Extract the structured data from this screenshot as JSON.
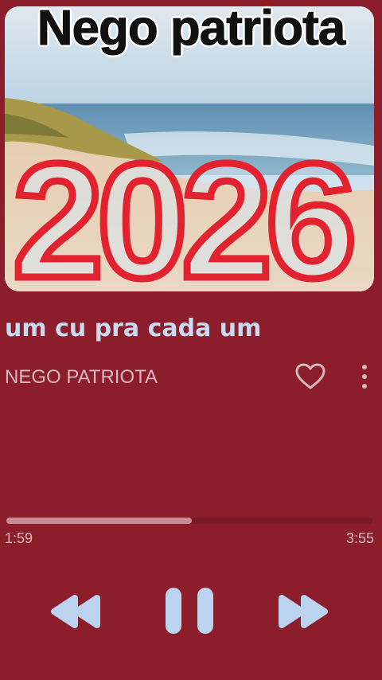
{
  "overlay": {
    "title": "Nego patriota"
  },
  "artwork": {
    "year_text": "2026",
    "icon": "album-artwork"
  },
  "track": {
    "title": "um cu pra cada um",
    "artist": "NEGO PATRIOTA",
    "elapsed": "1:59",
    "duration": "3:55",
    "progress_fraction": 0.506
  },
  "icons": {
    "favorite": "heart-icon",
    "more": "more-vertical-icon",
    "rewind": "rewind-icon",
    "pause": "pause-icon",
    "forward": "fast-forward-icon"
  },
  "colors": {
    "background": "#8c1d2b",
    "accent": "#c9dbf3",
    "progress_fill": "#c58c94",
    "year_red": "#e2232f"
  }
}
